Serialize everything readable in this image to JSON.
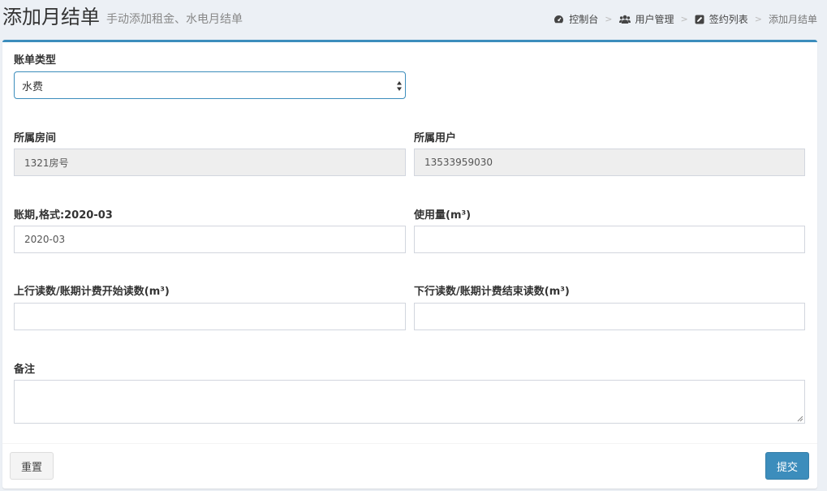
{
  "header": {
    "title": "添加月结单",
    "subtitle": "手动添加租金、水电月结单"
  },
  "breadcrumb": {
    "items": [
      {
        "label": "控制台",
        "icon": "dashboard-icon"
      },
      {
        "label": "用户管理",
        "icon": "users-icon"
      },
      {
        "label": "签约列表",
        "icon": "edit-icon"
      },
      {
        "label": "添加月结单",
        "icon": ""
      }
    ],
    "separator": ">"
  },
  "form": {
    "bill_type": {
      "label": "账单类型",
      "value": "水费"
    },
    "room": {
      "label": "所属房间",
      "value": "1321房号"
    },
    "user": {
      "label": "所属用户",
      "value": "13533959030"
    },
    "period": {
      "label": "账期,格式:2020-03",
      "value": "2020-03"
    },
    "usage": {
      "label": "使用量(m³)",
      "value": ""
    },
    "start_reading": {
      "label": "上行读数/账期计费开始读数(m³)",
      "value": ""
    },
    "end_reading": {
      "label": "下行读数/账期计费结束读数(m³)",
      "value": ""
    },
    "remark": {
      "label": "备注",
      "value": ""
    }
  },
  "footer": {
    "reset_label": "重置",
    "submit_label": "提交"
  },
  "colors": {
    "accent": "#3c8dbc",
    "background": "#ecf0f5",
    "readonly": "#eeeeee"
  }
}
